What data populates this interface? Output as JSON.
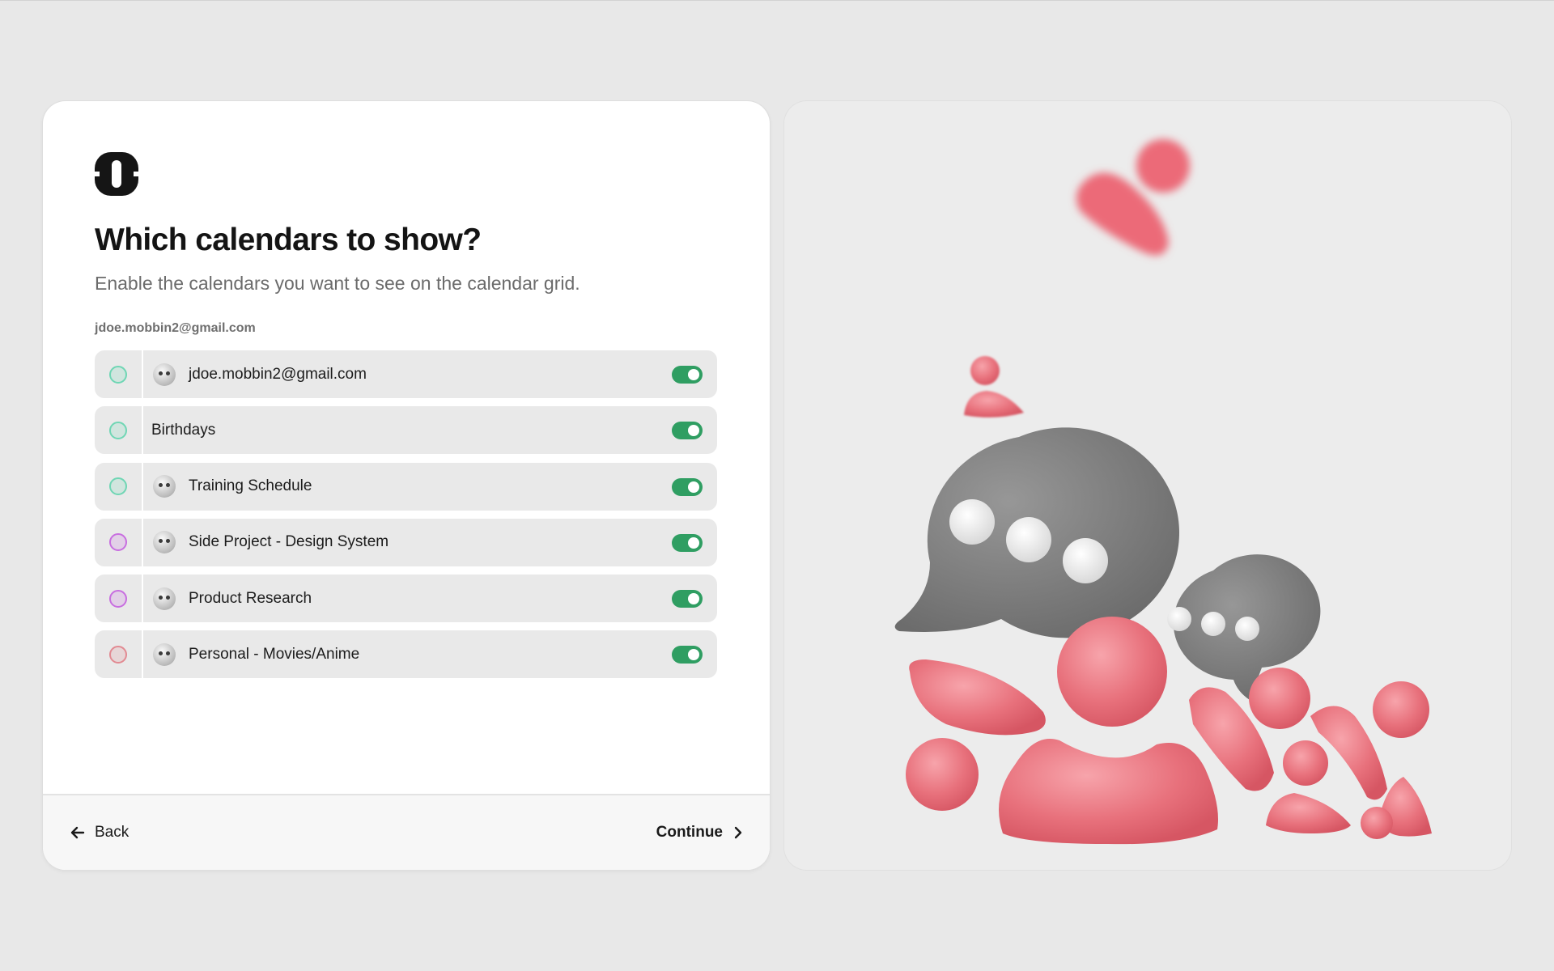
{
  "page": {
    "title": "Which calendars to show?",
    "subtitle": "Enable the calendars you want to see on the calendar grid.",
    "account_label": "jdoe.mobbin2@gmail.com"
  },
  "calendars": [
    {
      "name": "jdoe.mobbin2@gmail.com",
      "color": "#6fd6b4",
      "emoji_icon": "star-struck-face-icon",
      "enabled": true
    },
    {
      "name": "Birthdays",
      "color": "#6fd6b4",
      "emoji_icon": null,
      "enabled": true
    },
    {
      "name": "Training Schedule",
      "color": "#6fd6b4",
      "emoji_icon": "winking-face-icon",
      "enabled": true
    },
    {
      "name": "Side Project - Design System",
      "color": "#c86ee0",
      "emoji_icon": "sunglasses-face-icon",
      "enabled": true
    },
    {
      "name": "Product Research",
      "color": "#c86ee0",
      "emoji_icon": "grinning-squinting-face-icon",
      "enabled": true
    },
    {
      "name": "Personal - Movies/Anime",
      "color": "#e28a92",
      "emoji_icon": "robot-face-icon",
      "enabled": true
    }
  ],
  "footer": {
    "back_label": "Back",
    "continue_label": "Continue"
  },
  "colors": {
    "toggle_on": "#2f9e62",
    "illustration_pink": "#e8717c",
    "illustration_gray": "#7d7d7d"
  },
  "icons": {
    "logo": "brand-logo-icon",
    "back": "arrow-left-icon",
    "continue": "chevron-right-icon"
  }
}
